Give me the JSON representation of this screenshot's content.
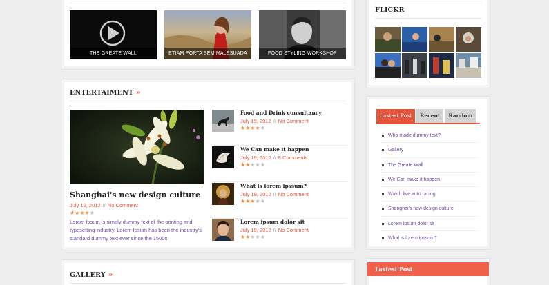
{
  "videos": [
    {
      "caption": "THE GREATE WALL"
    },
    {
      "caption": "ETIAM PORTA SEM MALESUADA"
    },
    {
      "caption": "FOOD STYLING WORKSHOP"
    }
  ],
  "entertainment": {
    "title": "ENTERTAIMENT",
    "arrow": "»",
    "feature": {
      "title": "Shanghai's new design culture",
      "date": "July 19, 2012",
      "sep": "//",
      "comments": "No Comment",
      "rating": 4,
      "excerpt": "Lorem Ipsum is simply dummy text of the printing and typesetting industry. Lorem Ipsum has been the industry's standard dummy text ever since the 1500s"
    },
    "list": [
      {
        "title": "Food and Drink consultancy",
        "date": "July 19, 2012",
        "sep": "//",
        "comments": "No Comment",
        "rating": 4
      },
      {
        "title": "We Can make it happen",
        "date": "July 19, 2012",
        "sep": "//",
        "comments": "8 Comments",
        "rating": 2
      },
      {
        "title": "What is lorem ipssum?",
        "date": "July 19, 2012",
        "sep": "//",
        "comments": "No Comment",
        "rating": 3
      },
      {
        "title": "Lorem ipsum dolor sit",
        "date": "July 19, 2012",
        "sep": "//",
        "comments": "No Comment",
        "rating": 2
      }
    ]
  },
  "gallery": {
    "title": "GALLERY",
    "arrow": "»"
  },
  "flickr": {
    "title": "FLICKR"
  },
  "tabs": {
    "labels": [
      "Lastest Post",
      "Recent",
      "Random"
    ],
    "active": 0,
    "posts": [
      "Who made dummy text?",
      "Gallery",
      "The Greate Wall",
      "We Can make it happen",
      "Watch live auto racing",
      "Shanghai's new design culture",
      "Lorem ipsum dolor sit",
      "What is lorem ipssum?"
    ]
  },
  "latest_post": {
    "title": "Lastest Post"
  },
  "colors": {
    "accent": "#e4533b",
    "star_on": "#f08a3c",
    "star_off": "#bbbbbb",
    "link": "#6b4a9b"
  },
  "icons": {
    "play": "play-icon",
    "star": "star-icon",
    "bullet": "square-bullet-icon"
  }
}
